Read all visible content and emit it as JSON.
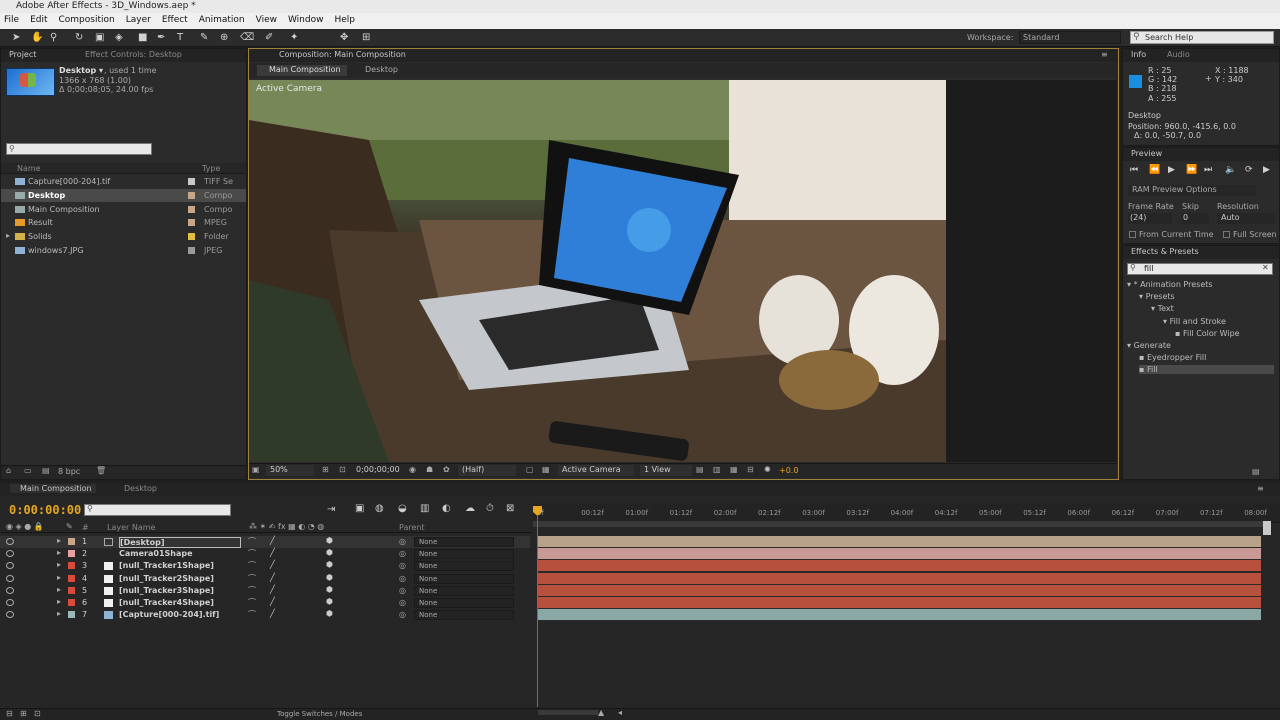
{
  "window": {
    "title": "Adobe After Effects - 3D_Windows.aep *"
  },
  "menu": [
    "File",
    "Edit",
    "Composition",
    "Layer",
    "Effect",
    "Animation",
    "View",
    "Window",
    "Help"
  ],
  "toolbar": {
    "workspace_label": "Workspace:",
    "workspace_value": "Standard",
    "search_placeholder": "Search Help"
  },
  "project": {
    "tabs": [
      "Project",
      "Effect Controls: Desktop"
    ],
    "selected_name": "Desktop ▾",
    "selected_used": ", used 1 time",
    "selected_dims": "1366 x 768 (1.00)",
    "selected_duration": "Δ 0;00;08;05, 24.00 fps",
    "col_name": "Name",
    "col_type": "Type",
    "items": [
      {
        "name": "Capture[000-204].tif",
        "type": "TIFF Se",
        "color": "#c8c8c8"
      },
      {
        "name": "Desktop",
        "type": "Compo",
        "color": "#c8a68a"
      },
      {
        "name": "Main Composition",
        "type": "Compo",
        "color": "#c8a68a"
      },
      {
        "name": "Result",
        "type": "MPEG",
        "color": "#c8a68a"
      },
      {
        "name": "Solids",
        "type": "Folder",
        "color": "#e0c040"
      },
      {
        "name": "windows7.JPG",
        "type": "JPEG",
        "color": "#9a9a9a"
      }
    ],
    "bpc": "8 bpc"
  },
  "composition": {
    "tab_label": "Composition: Main Composition",
    "breadcrumbs": [
      "Main Composition",
      "Desktop"
    ],
    "active_camera_label": "Active Camera",
    "zoom": "50%",
    "timecode": "0;00;00;00",
    "resolution": "(Half)",
    "view": "Active Camera",
    "views": "1 View",
    "exposure": "+0.0"
  },
  "info": {
    "tabs": [
      "Info",
      "Audio"
    ],
    "r": "R : 25",
    "g": "G : 142",
    "b": "B : 218",
    "a": "A : 255",
    "x": "X : 1188",
    "y": "Y : 340",
    "swatch": "#1a8ee0",
    "layer": "Desktop",
    "position": "Position: 960.0, -415.6, 0.0",
    "delta": "Δ: 0.0, -50.7, 0.0"
  },
  "preview": {
    "title": "Preview",
    "ram_options": "RAM Preview Options",
    "frame_rate_label": "Frame Rate",
    "skip_label": "Skip",
    "resolution_label": "Resolution",
    "frame_rate": "(24)",
    "skip": "0",
    "resolution": "Auto",
    "from_current": "From Current Time",
    "full_screen": "Full Screen"
  },
  "effects": {
    "title": "Effects & Presets",
    "search_value": "fill",
    "tree": [
      {
        "label": "* Animation Presets",
        "indent": 0
      },
      {
        "label": "Presets",
        "indent": 1
      },
      {
        "label": "Text",
        "indent": 2
      },
      {
        "label": "Fill and Stroke",
        "indent": 3
      },
      {
        "label": "Fill Color Wipe",
        "indent": 4
      },
      {
        "label": "Generate",
        "indent": 0
      },
      {
        "label": "Eyedropper Fill",
        "indent": 1
      },
      {
        "label": "Fill",
        "indent": 1
      }
    ]
  },
  "timeline": {
    "tabs": [
      "Main Composition",
      "Desktop"
    ],
    "current_time": "0:00:00:00",
    "col_layer_name": "Layer Name",
    "col_parent": "Parent",
    "ruler": [
      "0f",
      "00:12f",
      "01:00f",
      "01:12f",
      "02:00f",
      "02:12f",
      "03:00f",
      "03:12f",
      "04:00f",
      "04:12f",
      "05:00f",
      "05:12f",
      "06:00f",
      "06:12f",
      "07:00f",
      "07:12f",
      "08:00f"
    ],
    "layers": [
      {
        "num": "1",
        "name": "[Desktop]",
        "color": "#c8a68a",
        "parent": "None",
        "bar": "#b9a28a"
      },
      {
        "num": "2",
        "name": "Camera01Shape",
        "color": "#e8a0a0",
        "parent": "None",
        "bar": "#c99a95"
      },
      {
        "num": "3",
        "name": "[null_Tracker1Shape]",
        "color": "#d84a3a",
        "parent": "None",
        "bar": "#b8503e"
      },
      {
        "num": "4",
        "name": "[null_Tracker2Shape]",
        "color": "#d84a3a",
        "parent": "None",
        "bar": "#b8503e"
      },
      {
        "num": "5",
        "name": "[null_Tracker3Shape]",
        "color": "#d84a3a",
        "parent": "None",
        "bar": "#b8503e"
      },
      {
        "num": "6",
        "name": "[null_Tracker4Shape]",
        "color": "#d84a3a",
        "parent": "None",
        "bar": "#b8503e"
      },
      {
        "num": "7",
        "name": "[Capture[000-204].tif]",
        "color": "#9ab8b8",
        "parent": "None",
        "bar": "#8aa8a6"
      }
    ],
    "toggle_label": "Toggle Switches / Modes"
  }
}
